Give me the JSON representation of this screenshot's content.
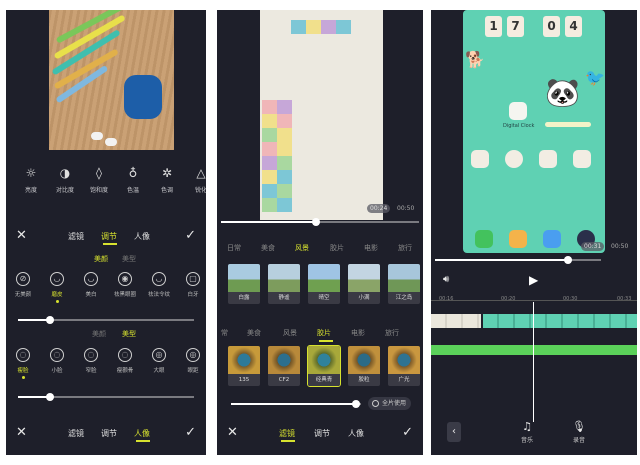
{
  "colors": {
    "accent": "#d7e22f",
    "panel_bg": "#1e1f2a",
    "phone_bg": "#5fd1b3",
    "green_track": "#5bd15a"
  },
  "panel1": {
    "tools": [
      {
        "label": "亮度",
        "icon": "sun-icon"
      },
      {
        "label": "对比度",
        "icon": "contrast-icon"
      },
      {
        "label": "饱和度",
        "icon": "droplet-icon"
      },
      {
        "label": "色温",
        "icon": "thermometer-icon"
      },
      {
        "label": "色调",
        "icon": "aperture-icon"
      },
      {
        "label": "锐化",
        "icon": "triangle-icon"
      }
    ],
    "top_bar": {
      "tabs": [
        "滤镜",
        "调节",
        "人像"
      ],
      "active": "调节"
    },
    "section_tabs_1": [
      "美颜",
      "美型"
    ],
    "face_items": [
      "无美颜",
      "磨皮",
      "美白",
      "祛黑眼圈",
      "祛法令纹",
      "白牙"
    ],
    "slider1": 0.18,
    "section_tabs_2": [
      "美颜",
      "美型"
    ],
    "shape_items": [
      "瘦脸",
      "小脸",
      "窄脸",
      "瘦颧骨",
      "大眼",
      "眼距"
    ],
    "slider2": 0.18,
    "bottom_bar": {
      "tabs": [
        "滤镜",
        "调节",
        "人像"
      ],
      "active": "人像"
    }
  },
  "panel2": {
    "time_current": "00:24",
    "time_total": "00:50",
    "scrub_progress": 0.48,
    "categories_1": [
      "日常",
      "美食",
      "风景",
      "胶片",
      "电影",
      "旅行"
    ],
    "active_category_1": "风景",
    "thumbs_1": [
      "白露",
      "静谧",
      "晴空",
      "小满",
      "江之岛"
    ],
    "categories_2": [
      "常",
      "美食",
      "风景",
      "胶片",
      "电影",
      "旅行"
    ],
    "active_category_2": "胶片",
    "thumbs_2": [
      "135",
      "CF2",
      "经典青",
      "胶粒",
      "广光"
    ],
    "intensity": 0.96,
    "apply_all": "全片使用",
    "bottom_bar": {
      "tabs": [
        "滤镜",
        "调节",
        "人像"
      ],
      "active": "滤镜"
    }
  },
  "panel3": {
    "clock_digits": [
      "1",
      "7",
      "0",
      "4"
    ],
    "widget_label": "Digital Clock",
    "time_current": "00:31",
    "time_total": "00:50",
    "scrub_progress": 0.8,
    "ruler": [
      "00:16",
      "00:20",
      "00:30",
      "00:33"
    ],
    "bottom": [
      {
        "label": "音乐",
        "icon": "music-note-icon"
      },
      {
        "label": "录音",
        "icon": "microphone-icon"
      }
    ]
  }
}
